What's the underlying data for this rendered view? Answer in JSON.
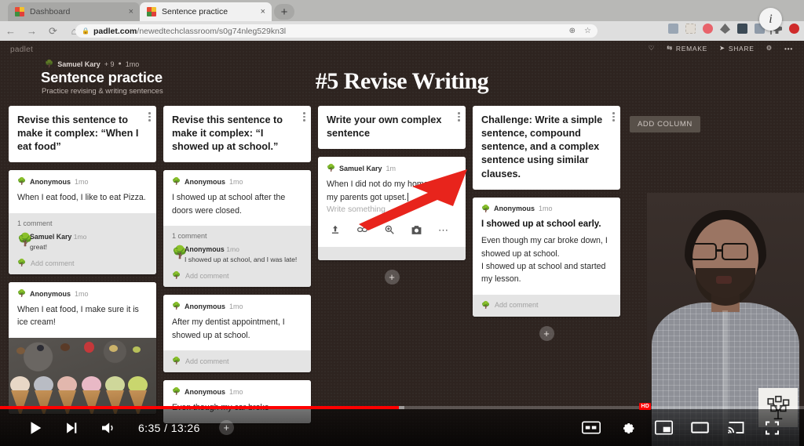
{
  "browser": {
    "tabs": [
      {
        "title": "Dashboard",
        "active": false,
        "favicon": "padlet-favicon",
        "close_label": "×"
      },
      {
        "title": "Sentence practice",
        "active": true,
        "favicon": "padlet-favicon",
        "close_label": "×"
      }
    ],
    "new_tab_label": "+",
    "nav": {
      "back": "←",
      "forward": "→",
      "reload": "⟳",
      "home": "⌂"
    },
    "omnibox": {
      "lock_icon": "lock-icon",
      "url_host": "padlet.com",
      "url_path": "/newedtechclassroom/s0g74nleg529kn3l",
      "install_icon": "install-app-icon",
      "bookmark_icon": "star-icon"
    },
    "info_bubble": "i"
  },
  "padlet": {
    "logo": "padlet",
    "toolbar": {
      "like_icon": "heart-icon",
      "remake_label": "REMAKE",
      "share_label": "SHARE",
      "settings_icon": "gear-icon",
      "more_label": "•••"
    },
    "meta": {
      "author": "Samuel Kary",
      "collaborators": "+ 9",
      "dot": "●",
      "time": "1mo"
    },
    "title": "Sentence practice",
    "subtitle": "Practice revising & writing sentences",
    "overlay_title": "#5 Revise Writing",
    "add_column_label": "ADD COLUMN",
    "add_post_label": "+",
    "columns": [
      {
        "heading": "Revise this sentence to make it complex: “When I eat food”",
        "posts": [
          {
            "author": "Anonymous",
            "time": "1mo",
            "text": "When I eat food, I like to eat Pizza.",
            "comment_count": "1 comment",
            "comments": [
              {
                "author": "Samuel Kary",
                "time": "1mo",
                "text": "great!"
              }
            ],
            "add_comment_label": "Add comment"
          },
          {
            "author": "Anonymous",
            "time": "1mo",
            "text": "When I eat food, I make sure it is ice cream!",
            "image": "ice-cream-cones-photo"
          }
        ]
      },
      {
        "heading": "Revise this sentence to make it complex: “I showed up at school.”",
        "posts": [
          {
            "author": "Anonymous",
            "time": "1mo",
            "text": "I showed up at school after the doors were closed.",
            "comment_count": "1 comment",
            "comments": [
              {
                "author": "Anonymous",
                "time": "1mo",
                "text": "I showed up at school, and I was late!"
              }
            ],
            "add_comment_label": "Add comment"
          },
          {
            "author": "Anonymous",
            "time": "1mo",
            "text": "After my dentist appointment, I showed up at school.",
            "add_comment_label": "Add comment"
          },
          {
            "author": "Anonymous",
            "time": "1mo",
            "text": "Even though my car broke"
          }
        ]
      },
      {
        "heading": "Write your own complex sentence",
        "compose": {
          "author": "Samuel Kary",
          "time": "1m",
          "text": "When I did not do my homework, my parents got upset.",
          "placeholder": "Write something …",
          "tools": [
            "upload-icon",
            "link-icon",
            "search-icon",
            "camera-icon",
            "more-icon"
          ]
        }
      },
      {
        "heading": "Challenge: Write a simple sentence, compound sentence, and a complex sentence using similar clauses.",
        "posts": [
          {
            "author": "Anonymous",
            "time": "1mo",
            "title": "I showed up at school early.",
            "text": "Even though my car broke down, I showed up at school.\nI showed up at school and started my lesson.",
            "add_comment_label": "Add comment"
          }
        ]
      }
    ]
  },
  "player": {
    "play_icon": "play-icon",
    "next_icon": "next-video-icon",
    "volume_icon": "volume-icon",
    "time": "6:35 / 13:26",
    "current_time": "6:35",
    "duration": "13:26",
    "progress_percent": 49.6,
    "buffered_percent": 50.3,
    "add_to_icon": "add-to-playlist-icon",
    "captions_label": "CC",
    "settings_icon": "settings-gear-icon",
    "quality_badge": "HD",
    "miniplayer_icon": "miniplayer-icon",
    "theater_icon": "theater-mode-icon",
    "cast_icon": "cast-icon",
    "fullscreen_icon": "fullscreen-icon"
  },
  "annotation": {
    "arrow": "red-arrow-pointing-up-right"
  },
  "colors": {
    "accent_red": "#ff0000",
    "board_bg": "#2e2420",
    "card_bg": "#ffffff"
  }
}
